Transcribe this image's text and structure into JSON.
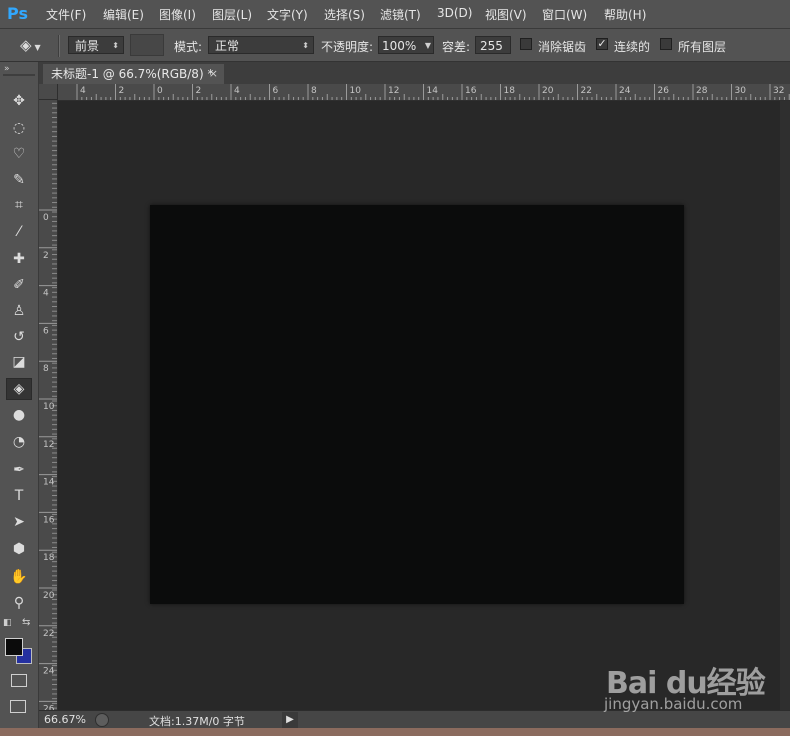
{
  "app": {
    "logo": "Ps"
  },
  "menu": [
    {
      "label": "文件(F)"
    },
    {
      "label": "编辑(E)"
    },
    {
      "label": "图像(I)"
    },
    {
      "label": "图层(L)"
    },
    {
      "label": "文字(Y)"
    },
    {
      "label": "选择(S)"
    },
    {
      "label": "滤镜(T)"
    },
    {
      "label": "3D(D)"
    },
    {
      "label": "视图(V)"
    },
    {
      "label": "窗口(W)"
    },
    {
      "label": "帮助(H)"
    }
  ],
  "options": {
    "fill_source": "前景",
    "mode_label": "模式:",
    "mode_value": "正常",
    "opacity_label": "不透明度:",
    "opacity_value": "100%",
    "tolerance_label": "容差:",
    "tolerance_value": "255",
    "antialias_label": "消除锯齿",
    "antialias_checked": false,
    "contiguous_label": "连续的",
    "contiguous_checked": true,
    "all_layers_label": "所有图层",
    "all_layers_checked": false,
    "check_glyph": "✓"
  },
  "tabs": [
    {
      "label": "未标题-1 @ 66.7%(RGB/8) *",
      "close": "×"
    }
  ],
  "ruler_h": [
    "4",
    "2",
    "0",
    "2",
    "4",
    "6",
    "8",
    "10",
    "12",
    "14",
    "16",
    "18",
    "20",
    "22",
    "24",
    "26",
    "28",
    "30",
    "32"
  ],
  "ruler_v": [
    "0",
    "2",
    "4",
    "6",
    "8",
    "10",
    "12",
    "14",
    "16",
    "18",
    "20",
    "22",
    "24",
    "26"
  ],
  "tools": [
    {
      "name": "move-tool",
      "glyph": "✥"
    },
    {
      "name": "marquee-tool",
      "glyph": "◌"
    },
    {
      "name": "lasso-tool",
      "glyph": "♡"
    },
    {
      "name": "quick-select-tool",
      "glyph": "✎"
    },
    {
      "name": "crop-tool",
      "glyph": "⌗"
    },
    {
      "name": "eyedropper-tool",
      "glyph": "⁄"
    },
    {
      "name": "healing-brush-tool",
      "glyph": "✚"
    },
    {
      "name": "brush-tool",
      "glyph": "✐"
    },
    {
      "name": "stamp-tool",
      "glyph": "♙"
    },
    {
      "name": "history-brush-tool",
      "glyph": "↺"
    },
    {
      "name": "eraser-tool",
      "glyph": "◪"
    },
    {
      "name": "paint-bucket-tool",
      "glyph": "◈",
      "active": true
    },
    {
      "name": "blur-tool",
      "glyph": "●"
    },
    {
      "name": "dodge-tool",
      "glyph": "◔"
    },
    {
      "name": "pen-tool",
      "glyph": "✒"
    },
    {
      "name": "type-tool",
      "glyph": "T"
    },
    {
      "name": "path-select-tool",
      "glyph": "➤"
    },
    {
      "name": "shape-tool",
      "glyph": "⬢"
    },
    {
      "name": "hand-tool",
      "glyph": "✋"
    },
    {
      "name": "zoom-tool",
      "glyph": "⚲"
    }
  ],
  "colors": {
    "foreground": "#0b0b0b",
    "background": "#2430a0",
    "canvas": "#0b0c0c",
    "logo": "#31a8ff"
  },
  "status": {
    "zoom": "66.67%",
    "doc_info": "文档:1.37M/0 字节",
    "arrow": "▶"
  },
  "watermark": {
    "brand": "Bai du经验",
    "url": "jingyan.baidu.com"
  }
}
